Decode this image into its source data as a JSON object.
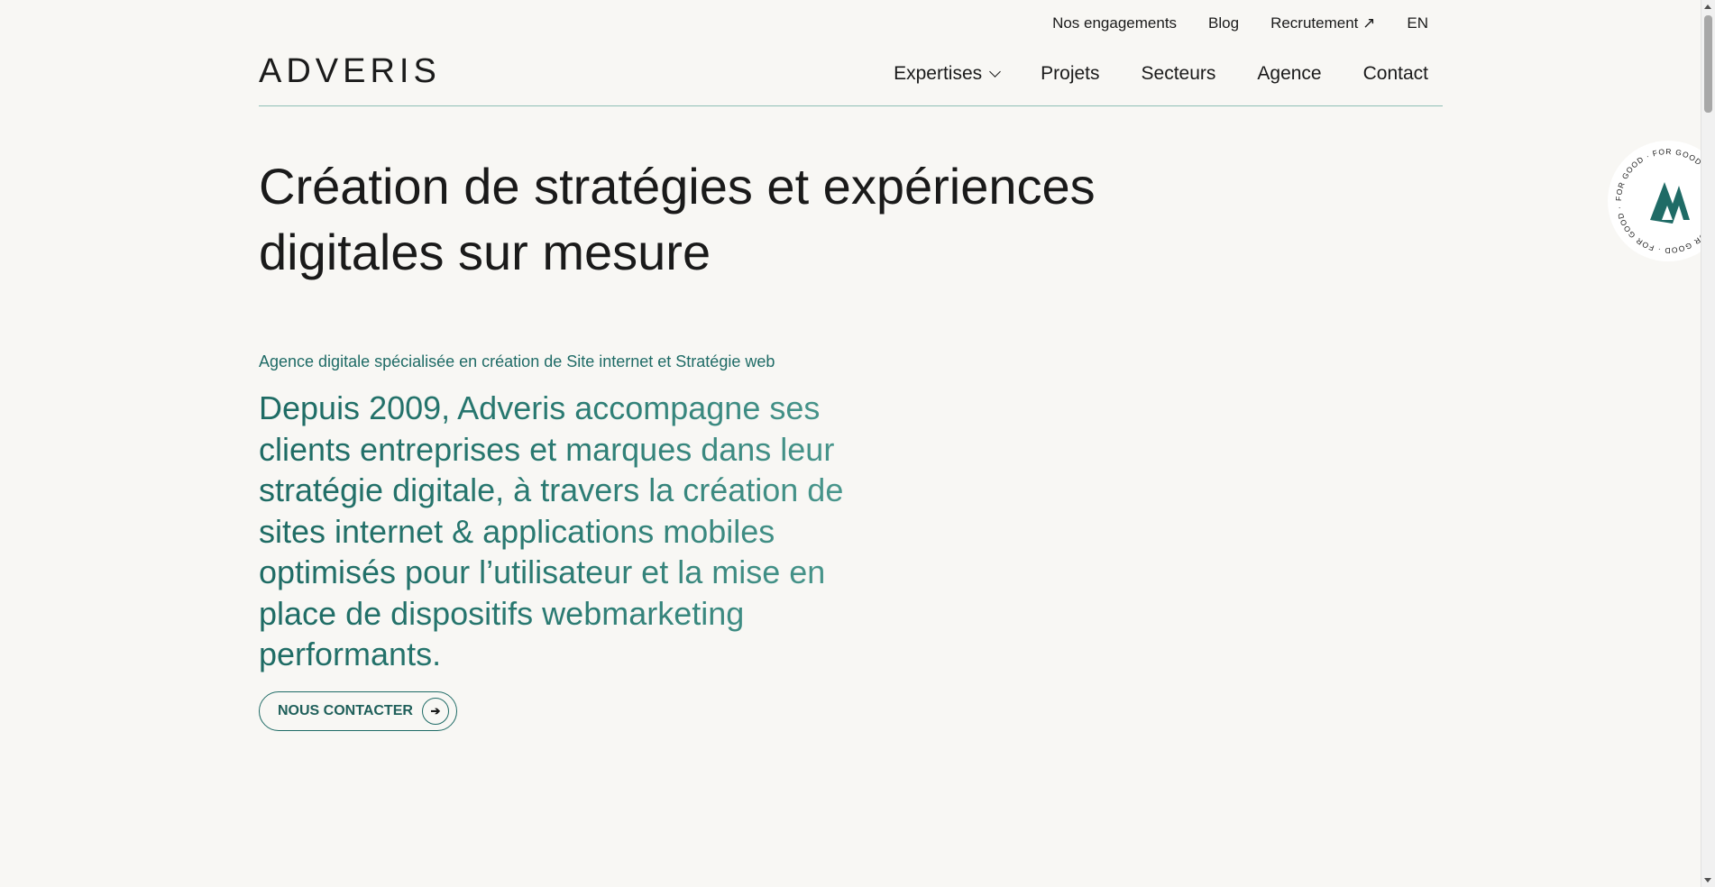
{
  "topbar": {
    "items": [
      {
        "label": "Nos engagements"
      },
      {
        "label": "Blog"
      },
      {
        "label": "Recrutement ↗"
      },
      {
        "label": "EN"
      }
    ]
  },
  "header": {
    "logo": "ADVERIS"
  },
  "nav": {
    "items": [
      {
        "label": "Expertises"
      },
      {
        "label": "Projets"
      },
      {
        "label": "Secteurs"
      },
      {
        "label": "Agence"
      },
      {
        "label": "Contact"
      }
    ]
  },
  "hero": {
    "title_line1": "Création de stratégies et expériences",
    "title_line2": "digitales sur mesure",
    "subtitle": "Agence digitale spécialisée en création de Site internet et Stratégie web",
    "lead": "Depuis 2009, Adveris accompagne ses clients entreprises et marques dans leur stratégie digitale, à travers la création de sites internet & applications mobiles optimisés pour l’utilisateur et la mise en place de dispositifs webmarketing performants.",
    "cta_label": "NOUS CONTACTER",
    "cta_icon": "arrow-right-icon"
  },
  "badge": {
    "ring_text": "FOR GOOD · FOR GOOD · FOR GOOD · FOR GOOD · FOR GOOD ·",
    "icon": "adveris-mark-icon",
    "accent": "#1f6b66"
  },
  "colors": {
    "background": "#f8f7f4",
    "accent": "#1f6b66",
    "divider": "#8fbfb5"
  }
}
